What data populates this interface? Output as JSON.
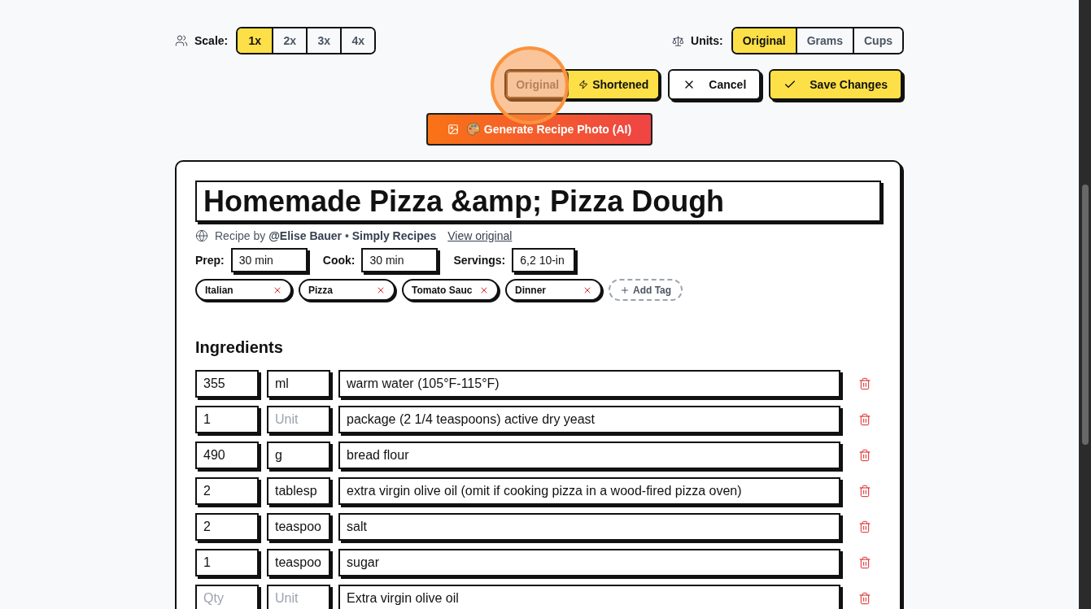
{
  "scale": {
    "label": "Scale:",
    "options": [
      {
        "label": "1x",
        "selected": true
      },
      {
        "label": "2x",
        "selected": false
      },
      {
        "label": "3x",
        "selected": false
      },
      {
        "label": "4x",
        "selected": false
      }
    ]
  },
  "units": {
    "label": "Units:",
    "options": [
      {
        "label": "Original",
        "selected": true
      },
      {
        "label": "Grams",
        "selected": false
      },
      {
        "label": "Cups",
        "selected": false
      }
    ]
  },
  "version_toggle": {
    "options": [
      {
        "label": "Original",
        "selected": false,
        "highlighted": true
      },
      {
        "label": "Shortened",
        "selected": true,
        "highlighted": false
      }
    ]
  },
  "actions": [
    {
      "kind": "cancel",
      "label": "Cancel"
    },
    {
      "kind": "save",
      "label": "Save Changes"
    }
  ],
  "generate_button": {
    "label": "Generate Recipe Photo (AI)"
  },
  "recipe": {
    "title": "Homemade Pizza &amp; Pizza Dough",
    "attribution": {
      "text": "Recipe by **@Elise Bauer** • **Simply Recipes**",
      "link": "View original"
    },
    "times": [
      {
        "label": "Prep:",
        "value": "30 min"
      },
      {
        "label": "Cook:",
        "value": "30 min"
      },
      {
        "label": "Servings:",
        "value": "6,2 10-in"
      }
    ],
    "tags": [
      {
        "label": "Italian"
      },
      {
        "label": "Pizza"
      },
      {
        "label": "Tomato Sauc"
      },
      {
        "label": "Dinner"
      }
    ],
    "add_tag": "Add Tag",
    "ingredients": {
      "heading": "Ingredients",
      "rows": [
        {
          "qty": "355",
          "unit": "ml",
          "name": "warm water (105°F-115°F)"
        },
        {
          "qty": "1",
          "unit_placeholder": "Unit",
          "name": "package (2 1/4 teaspoons) active dry yeast"
        },
        {
          "qty": "490",
          "unit": "g",
          "name": "bread flour"
        },
        {
          "qty": "2",
          "unit": "tablesp",
          "name": "extra virgin olive oil (omit if cooking pizza in a wood-fired pizza oven)"
        },
        {
          "qty": "2",
          "unit": "teaspoo",
          "name": "salt"
        },
        {
          "qty": "1",
          "unit": "teaspoo",
          "name": "sugar"
        },
        {
          "qty_placeholder": "Qty",
          "unit_placeholder": "Unit",
          "name": "Extra virgin olive oil"
        }
      ]
    }
  }
}
